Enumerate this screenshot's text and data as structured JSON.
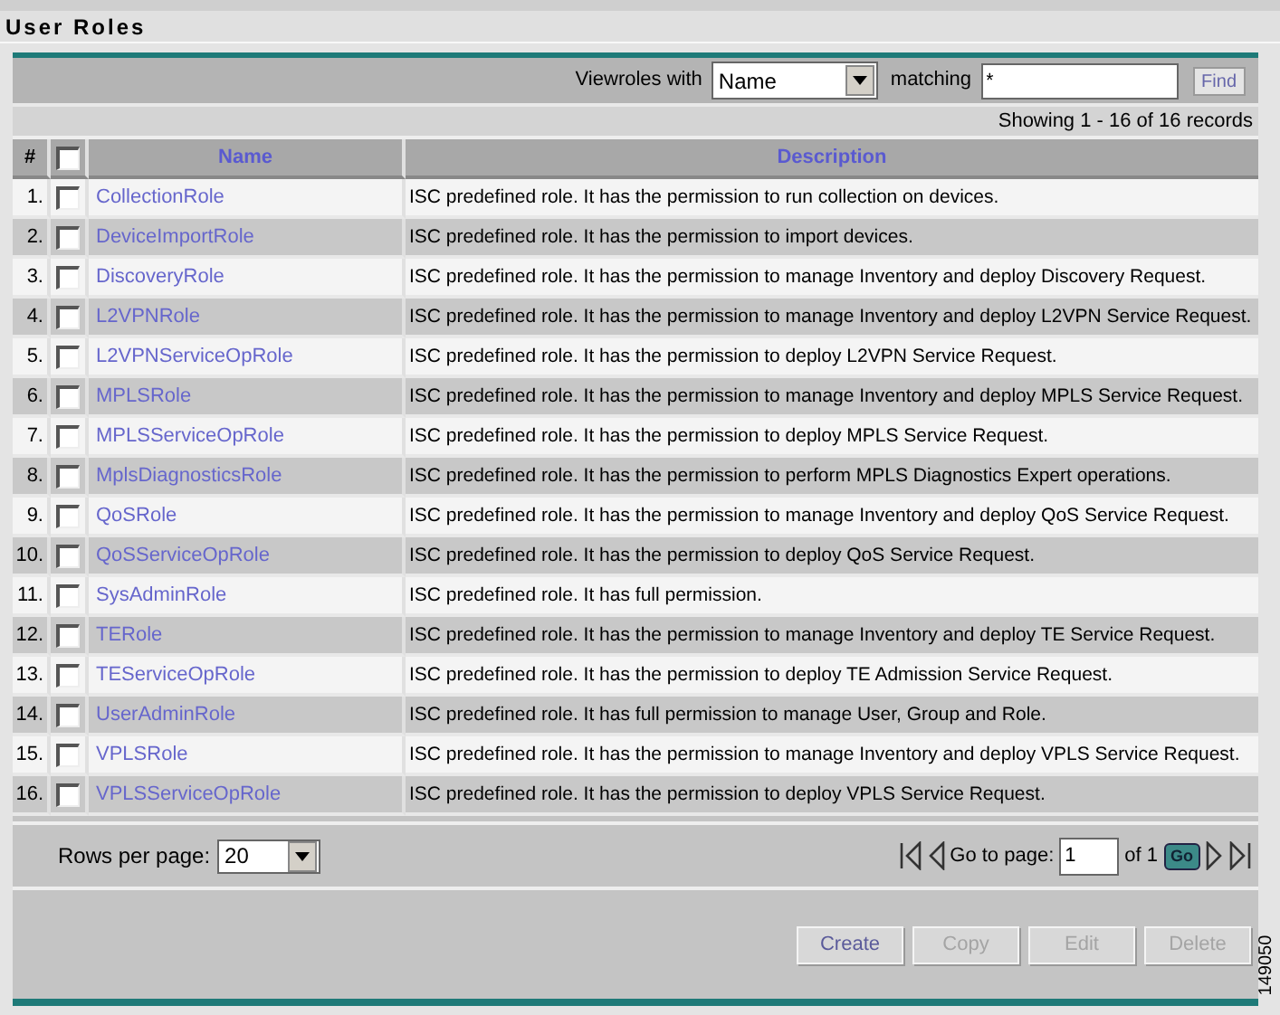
{
  "page_title": "User Roles",
  "filter": {
    "label": "Viewroles with",
    "field": "Name",
    "matching_label": "matching",
    "value": "*",
    "find_button": "Find"
  },
  "record_count": "Showing 1 - 16 of 16 records",
  "table": {
    "columns": [
      "#",
      "Name",
      "Description"
    ],
    "select_all_checked": false,
    "rows": [
      {
        "index": "1.",
        "name": "CollectionRole",
        "description": "ISC predefined role. It has the permission to run collection on devices.",
        "checked": false
      },
      {
        "index": "2.",
        "name": "DeviceImportRole",
        "description": "ISC predefined role. It has the permission to import devices.",
        "checked": false
      },
      {
        "index": "3.",
        "name": "DiscoveryRole",
        "description": "ISC predefined role. It has the permission to manage Inventory and deploy Discovery Request.",
        "checked": false
      },
      {
        "index": "4.",
        "name": "L2VPNRole",
        "description": "ISC predefined role. It has the permission to manage Inventory and deploy L2VPN Service Request.",
        "checked": false
      },
      {
        "index": "5.",
        "name": "L2VPNServiceOpRole",
        "description": "ISC predefined role. It has the permission to deploy L2VPN Service Request.",
        "checked": false
      },
      {
        "index": "6.",
        "name": "MPLSRole",
        "description": "ISC predefined role. It has the permission to manage Inventory and deploy MPLS Service Request.",
        "checked": false
      },
      {
        "index": "7.",
        "name": "MPLSServiceOpRole",
        "description": "ISC predefined role. It has the permission to deploy MPLS Service Request.",
        "checked": false
      },
      {
        "index": "8.",
        "name": "MplsDiagnosticsRole",
        "description": "ISC predefined role. It has the permission to perform MPLS Diagnostics Expert operations.",
        "checked": false
      },
      {
        "index": "9.",
        "name": "QoSRole",
        "description": "ISC predefined role. It has the permission to manage Inventory and deploy QoS Service Request.",
        "checked": false
      },
      {
        "index": "10.",
        "name": "QoSServiceOpRole",
        "description": "ISC predefined role. It has the permission to deploy QoS Service Request.",
        "checked": false
      },
      {
        "index": "11.",
        "name": "SysAdminRole",
        "description": "ISC predefined role. It has full permission.",
        "checked": false
      },
      {
        "index": "12.",
        "name": "TERole",
        "description": "ISC predefined role. It has the permission to manage Inventory and deploy TE Service Request.",
        "checked": false
      },
      {
        "index": "13.",
        "name": "TEServiceOpRole",
        "description": "ISC predefined role. It has the permission to deploy TE Admission Service Request.",
        "checked": false
      },
      {
        "index": "14.",
        "name": "UserAdminRole",
        "description": "ISC predefined role. It has full permission to manage User, Group and Role.",
        "checked": false
      },
      {
        "index": "15.",
        "name": "VPLSRole",
        "description": "ISC predefined role. It has the permission to manage Inventory and deploy VPLS Service Request.",
        "checked": false
      },
      {
        "index": "16.",
        "name": "VPLSServiceOpRole",
        "description": "ISC predefined role. It has the permission to deploy VPLS Service Request.",
        "checked": false
      }
    ]
  },
  "pagination": {
    "rows_label": "Rows per page:",
    "rows_value": "20",
    "goto_label": "Go to page:",
    "page": "1",
    "of_label": "of 1",
    "go_button": "Go"
  },
  "actions": [
    {
      "label": "Create",
      "disabled": false
    },
    {
      "label": "Copy",
      "disabled": true
    },
    {
      "label": "Edit",
      "disabled": true
    },
    {
      "label": "Delete",
      "disabled": true
    }
  ],
  "figure_number": "149050"
}
